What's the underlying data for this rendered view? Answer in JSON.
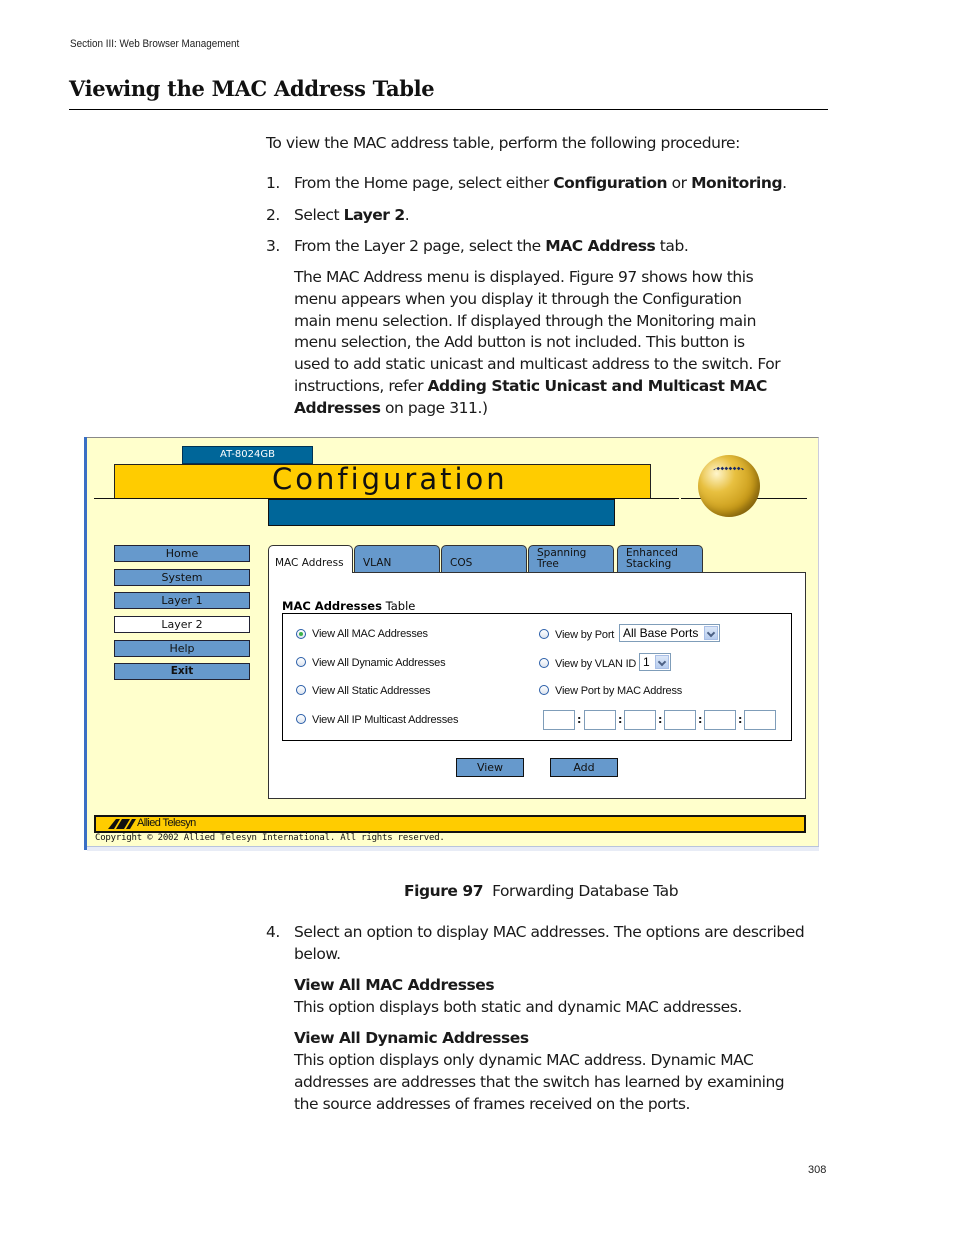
{
  "header": {
    "section": "Section III: Web Browser Management",
    "title": "Viewing the MAC Address Table"
  },
  "intro": "To view the MAC address table, perform the following procedure:",
  "steps": [
    {
      "num": "1.",
      "parts": [
        "From the Home page, select either ",
        "Configuration",
        " or ",
        "Monitoring",
        "."
      ]
    },
    {
      "num": "2.",
      "parts": [
        "Select ",
        "Layer 2",
        "."
      ]
    },
    {
      "num": "3.",
      "parts": [
        "From the Layer 2 page, select the ",
        "MAC Address",
        " tab."
      ]
    }
  ],
  "step3_note": {
    "lines": [
      "The MAC Address menu is displayed. Figure 97 shows how this",
      "menu appears when you display it through the Configuration",
      "main menu selection. If displayed through the Monitoring main",
      "menu selection, the Add button is not included. This button is",
      "used to add static unicast and multicast address to the switch. For"
    ],
    "line6_prefix": "instructions, refer ",
    "line6_bold": "Adding Static Unicast and Multicast MAC",
    "line7_bold": "Addresses",
    "line7_suffix": " on page 311.)"
  },
  "screenshot": {
    "model": "AT-8024GB",
    "heading": "Configuration",
    "nav": [
      "Home",
      "System",
      "Layer 1",
      "Layer 2",
      "Help",
      "Exit"
    ],
    "nav_active": "Layer 2",
    "tabs": [
      {
        "label": "MAC Address",
        "active": true
      },
      {
        "label": "VLAN",
        "active": false
      },
      {
        "label": "COS",
        "active": false
      },
      {
        "label_line1": "Spanning",
        "label_line2": "Tree",
        "active": false
      },
      {
        "label_line1": "Enhanced",
        "label_line2": "Stacking",
        "active": false
      }
    ],
    "table_title_bold": "MAC Addresses",
    "table_title_rest": " Table",
    "options_left": [
      {
        "label": "View All MAC Addresses",
        "checked": true
      },
      {
        "label": "View All Dynamic Addresses",
        "checked": false
      },
      {
        "label": "View All Static Addresses",
        "checked": false
      },
      {
        "label": "View All IP Multicast Addresses",
        "checked": false
      }
    ],
    "options_right": [
      {
        "label": "View by Port",
        "checked": false
      },
      {
        "label": "View by VLAN ID",
        "checked": false
      },
      {
        "label": "View Port by MAC Address",
        "checked": false
      }
    ],
    "port_select": "All Base Ports",
    "vlan_select": "1",
    "mac_octets": [
      "",
      "",
      "",
      "",
      "",
      ""
    ],
    "mac_separator": ":",
    "buttons": {
      "view": "View",
      "add": "Add"
    },
    "brand": "Allied Telesyn",
    "copyright": "Copyright © 2002 Allied Telesyn International. All rights reserved."
  },
  "caption": {
    "bold": "Figure 97",
    "text": "Forwarding Database Tab"
  },
  "step4": {
    "num": "4.",
    "line1": "Select an option to display MAC addresses. The options are described",
    "line2": "below."
  },
  "option_descriptions": [
    {
      "title": "View All MAC Addresses",
      "lines": [
        "This option displays both static and dynamic MAC addresses."
      ]
    },
    {
      "title": "View All Dynamic Addresses",
      "lines": [
        "This option displays only dynamic MAC address. Dynamic MAC",
        "addresses are addresses that the switch has learned by examining",
        "the source addresses of frames received on the ports."
      ]
    }
  ],
  "page_number": "308"
}
